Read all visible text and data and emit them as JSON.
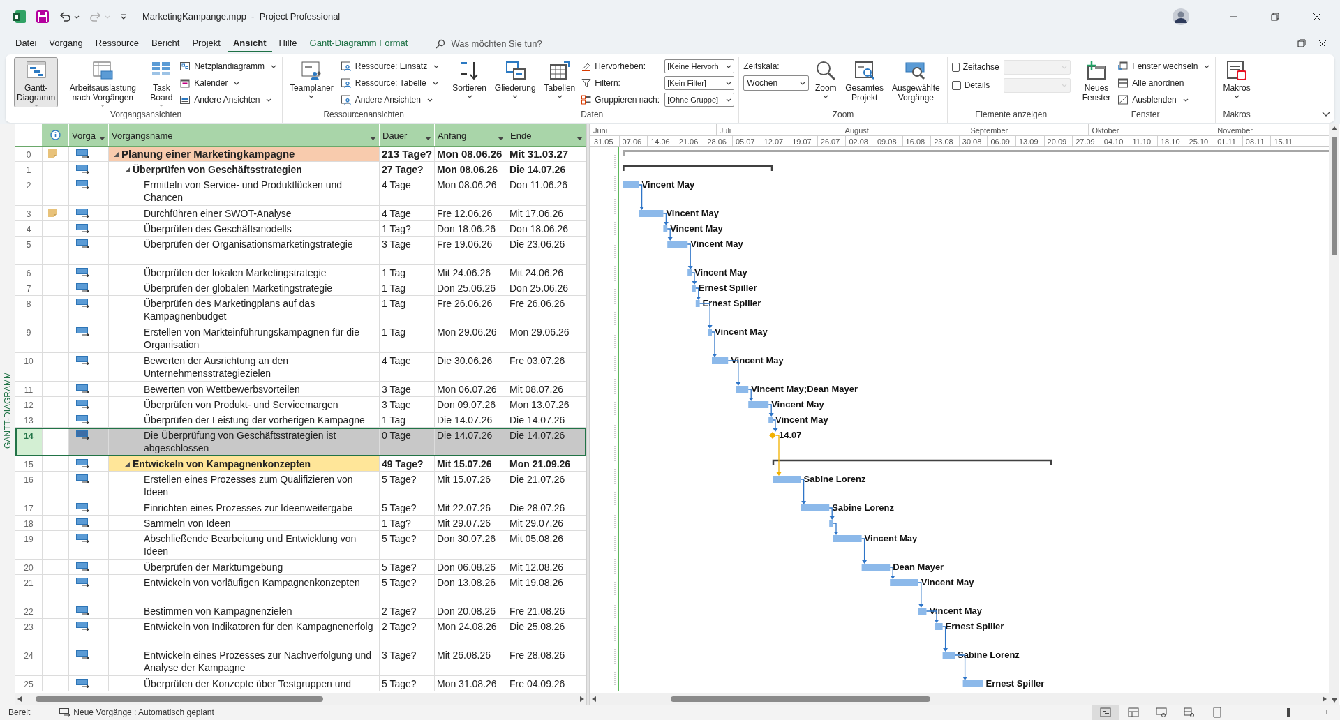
{
  "title_bar": {
    "title": "MarketingKampange.mpp  -  Project Professional"
  },
  "menu_tabs": [
    {
      "label": "Datei",
      "kind": "standard",
      "selected": false
    },
    {
      "label": "Vorgang",
      "kind": "standard",
      "selected": false
    },
    {
      "label": "Ressource",
      "kind": "standard",
      "selected": false
    },
    {
      "label": "Bericht",
      "kind": "standard",
      "selected": false
    },
    {
      "label": "Projekt",
      "kind": "standard",
      "selected": false
    },
    {
      "label": "Ansicht",
      "kind": "standard",
      "selected": true
    },
    {
      "label": "Hilfe",
      "kind": "standard",
      "selected": false
    },
    {
      "label": "Gantt-Diagramm Format",
      "kind": "contextual",
      "selected": false
    }
  ],
  "search": {
    "placeholder": "Was möchten Sie tun?"
  },
  "ribbon": {
    "groups": [
      {
        "label": "Vorgangsansichten",
        "items": [
          {
            "kind": "large",
            "label": "Gantt-Diagramm",
            "dropdown": true,
            "selected": true
          },
          {
            "kind": "large",
            "label": "Arbeitsauslastung nach Vorgängen",
            "dropdown": true,
            "selected": false
          },
          {
            "kind": "large",
            "label": "Task Board",
            "dropdown": true,
            "selected": false
          },
          {
            "kind": "small",
            "label": "Netzplandiagramm",
            "dropdown": true,
            "selected": false
          },
          {
            "kind": "small",
            "label": "Kalender",
            "dropdown": true,
            "selected": false
          },
          {
            "kind": "small",
            "label": "Andere Ansichten",
            "dropdown": true,
            "selected": false
          }
        ]
      },
      {
        "label": "Ressourcenansichten",
        "items": [
          {
            "kind": "large",
            "label": "Teamplaner",
            "dropdown": true,
            "selected": false
          },
          {
            "kind": "small",
            "label": "Ressource: Einsatz",
            "dropdown": true,
            "selected": false
          },
          {
            "kind": "small",
            "label": "Ressource: Tabelle",
            "dropdown": true,
            "selected": false
          },
          {
            "kind": "small",
            "label": "Andere Ansichten",
            "dropdown": true,
            "selected": false
          }
        ]
      },
      {
        "label": "Daten",
        "items": [
          {
            "kind": "large",
            "label": "Sortieren",
            "dropdown": true,
            "selected": false
          },
          {
            "kind": "large",
            "label": "Gliederung",
            "dropdown": true,
            "selected": false
          },
          {
            "kind": "large",
            "label": "Tabellen",
            "dropdown": true,
            "selected": false
          },
          {
            "kind": "labeled_select",
            "label": "Hervorheben:",
            "value": "[Keine Hervorh"
          },
          {
            "kind": "labeled_select",
            "label": "Filtern:",
            "value": "[Kein Filter]"
          },
          {
            "kind": "labeled_select",
            "label": "Gruppieren nach:",
            "value": "[Ohne Gruppe]"
          }
        ]
      },
      {
        "label": "Zoom",
        "items": [
          {
            "kind": "select_stacked",
            "label": "Zeitskala:",
            "value": "Wochen"
          },
          {
            "kind": "large",
            "label": "Zoom",
            "dropdown": true,
            "selected": false
          },
          {
            "kind": "large",
            "label": "Gesamtes Projekt",
            "dropdown": false,
            "selected": false
          },
          {
            "kind": "large",
            "label": "Ausgewählte Vorgänge",
            "dropdown": false,
            "selected": false
          }
        ]
      },
      {
        "label": "Elemente anzeigen",
        "items": [
          {
            "kind": "checkbox",
            "label": "Zeitachse",
            "checked": false
          },
          {
            "kind": "checkbox",
            "label": "Details",
            "checked": false
          }
        ]
      },
      {
        "label": "Fenster",
        "items": [
          {
            "kind": "large",
            "label": "Neues Fenster",
            "dropdown": false,
            "selected": false
          },
          {
            "kind": "small",
            "label": "Fenster wechseln",
            "dropdown": true,
            "selected": false
          },
          {
            "kind": "small",
            "label": "Alle anordnen",
            "dropdown": false,
            "selected": false
          },
          {
            "kind": "small",
            "label": "Ausblenden",
            "dropdown": true,
            "selected": false
          }
        ]
      },
      {
        "label": "Makros",
        "items": [
          {
            "kind": "large",
            "label": "Makros",
            "dropdown": true,
            "selected": false
          }
        ]
      }
    ]
  },
  "view_label": "GANTT-DIAGRAMM",
  "table": {
    "columns": [
      {
        "label": "Vorga"
      },
      {
        "label": "Vorgangsname"
      },
      {
        "label": "Dauer"
      },
      {
        "label": "Anfang"
      },
      {
        "label": "Ende"
      }
    ],
    "rows": [
      {
        "number": "0",
        "note": true,
        "name": "Planung einer Marketingkampagne",
        "duration": "213 Tage?",
        "start": "Mon 08.06.26",
        "finish": "Mit 31.03.27",
        "kind": "summary",
        "expanded": true,
        "selected": false,
        "color": "#f8cbad",
        "children": [
          {
            "number": "1",
            "note": false,
            "name": "Überprüfen von Geschäftsstrategien",
            "duration": "27 Tage?",
            "start": "Mon 08.06.26",
            "finish": "Die 14.07.26",
            "kind": "summary",
            "expanded": true,
            "selected": false,
            "children": [
              {
                "number": "2",
                "note": false,
                "name": "Ermitteln von Service- und Produktlücken und Chancen",
                "duration": "4 Tage",
                "start": "Mon 08.06.26",
                "finish": "Don 11.06.26",
                "kind": "task",
                "selected": false,
                "gantt_label": "Vincent May"
              },
              {
                "number": "3",
                "note": true,
                "name": "Durchführen einer SWOT-Analyse",
                "duration": "4 Tage",
                "start": "Fre 12.06.26",
                "finish": "Mit 17.06.26",
                "kind": "task",
                "selected": false,
                "gantt_label": "Vincent May"
              },
              {
                "number": "4",
                "note": false,
                "name": "Überprüfen des Geschäftsmodells",
                "duration": "1 Tag?",
                "start": "Don 18.06.26",
                "finish": "Don 18.06.26",
                "kind": "task",
                "selected": false,
                "gantt_label": "Vincent May"
              },
              {
                "number": "5",
                "note": false,
                "name": "Überprüfen der Organisationsmarketingstrategie",
                "duration": "3 Tage",
                "start": "Fre 19.06.26",
                "finish": "Die 23.06.26",
                "kind": "task",
                "selected": false,
                "gantt_label": "Vincent May"
              },
              {
                "number": "6",
                "note": false,
                "name": "Überprüfen der lokalen Marketingstrategie",
                "duration": "1 Tag",
                "start": "Mit 24.06.26",
                "finish": "Mit 24.06.26",
                "kind": "task",
                "selected": false,
                "gantt_label": "Vincent May"
              },
              {
                "number": "7",
                "note": false,
                "name": "Überprüfen der globalen Marketingstrategie",
                "duration": "1 Tag",
                "start": "Don 25.06.26",
                "finish": "Don 25.06.26",
                "kind": "task",
                "selected": false,
                "gantt_label": "Ernest Spiller"
              },
              {
                "number": "8",
                "note": false,
                "name": "Überprüfen des Marketingplans auf das Kampagnenbudget",
                "duration": "1 Tag",
                "start": "Fre 26.06.26",
                "finish": "Fre 26.06.26",
                "kind": "task",
                "selected": false,
                "gantt_label": "Ernest Spiller"
              },
              {
                "number": "9",
                "note": false,
                "name": "Erstellen von Markteinführungskampagnen für die Organisation",
                "duration": "1 Tag",
                "start": "Mon 29.06.26",
                "finish": "Mon 29.06.26",
                "kind": "task",
                "selected": false,
                "gantt_label": "Vincent May"
              },
              {
                "number": "10",
                "note": false,
                "name": "Bewerten der Ausrichtung an den Unternehmensstrategiezielen",
                "duration": "4 Tage",
                "start": "Die 30.06.26",
                "finish": "Fre 03.07.26",
                "kind": "task",
                "selected": false,
                "gantt_label": "Vincent May"
              },
              {
                "number": "11",
                "note": false,
                "name": "Bewerten von Wettbewerbsvorteilen",
                "duration": "3 Tage",
                "start": "Mon 06.07.26",
                "finish": "Mit 08.07.26",
                "kind": "task",
                "selected": false,
                "gantt_label": "Vincent May;Dean Mayer"
              },
              {
                "number": "12",
                "note": false,
                "name": "Überprüfen von Produkt- und Servicemargen",
                "duration": "3 Tage",
                "start": "Don 09.07.26",
                "finish": "Mon 13.07.26",
                "kind": "task",
                "selected": false,
                "gantt_label": "Vincent May"
              },
              {
                "number": "13",
                "note": false,
                "name": "Überprüfen der Leistung der vorherigen Kampagne",
                "duration": "1 Tag",
                "start": "Die 14.07.26",
                "finish": "Die 14.07.26",
                "kind": "task",
                "selected": false,
                "gantt_label": "Vincent May"
              },
              {
                "number": "14",
                "note": false,
                "name": "Die Überprüfung von Geschäftsstrategien ist abgeschlossen",
                "duration": "0 Tage",
                "start": "Die 14.07.26",
                "finish": "Die 14.07.26",
                "kind": "milestone",
                "selected": true,
                "gantt_label": "14.07"
              }
            ]
          },
          {
            "number": "15",
            "note": false,
            "name": "Entwickeln von Kampagnenkonzepten",
            "duration": "49 Tage?",
            "start": "Mit 15.07.26",
            "finish": "Mon 21.09.26",
            "kind": "summary",
            "expanded": true,
            "selected": false,
            "color": "#ffe699",
            "children": [
              {
                "number": "16",
                "note": false,
                "name": "Erstellen eines Prozesses zum Qualifizieren von Ideen",
                "duration": "5 Tage?",
                "start": "Mit 15.07.26",
                "finish": "Die 21.07.26",
                "kind": "task",
                "selected": false,
                "gantt_label": "Sabine Lorenz"
              },
              {
                "number": "17",
                "note": false,
                "name": "Einrichten eines Prozesses zur Ideenweitergabe",
                "duration": "5 Tage?",
                "start": "Mit 22.07.26",
                "finish": "Die 28.07.26",
                "kind": "task",
                "selected": false,
                "gantt_label": "Sabine Lorenz"
              },
              {
                "number": "18",
                "note": false,
                "name": "Sammeln von Ideen",
                "duration": "1 Tag?",
                "start": "Mit 29.07.26",
                "finish": "Mit 29.07.26",
                "kind": "task",
                "selected": false
              },
              {
                "number": "19",
                "note": false,
                "name": "Abschließende Bearbeitung und Entwicklung von Ideen",
                "duration": "5 Tage?",
                "start": "Don 30.07.26",
                "finish": "Mit 05.08.26",
                "kind": "task",
                "selected": false,
                "gantt_label": "Vincent May"
              },
              {
                "number": "20",
                "note": false,
                "name": "Überprüfen der Marktumgebung",
                "duration": "5 Tage?",
                "start": "Don 06.08.26",
                "finish": "Mit 12.08.26",
                "kind": "task",
                "selected": false,
                "gantt_label": "Dean Mayer"
              },
              {
                "number": "21",
                "note": false,
                "name": "Entwickeln von vorläufigen Kampagnenkonzepten",
                "duration": "5 Tage?",
                "start": "Don 13.08.26",
                "finish": "Mit 19.08.26",
                "kind": "task",
                "selected": false,
                "gantt_label": "Vincent May"
              },
              {
                "number": "22",
                "note": false,
                "name": "Bestimmen von Kampagnenzielen",
                "duration": "2 Tage?",
                "start": "Don 20.08.26",
                "finish": "Fre 21.08.26",
                "kind": "task",
                "selected": false,
                "gantt_label": "Vincent May"
              },
              {
                "number": "23",
                "note": false,
                "name": "Entwickeln von Indikatoren für den Kampagnenerfolg",
                "duration": "2 Tage?",
                "start": "Mon 24.08.26",
                "finish": "Die 25.08.26",
                "kind": "task",
                "selected": false,
                "gantt_label": "Ernest Spiller"
              },
              {
                "number": "24",
                "note": false,
                "name": "Entwickeln eines Prozesses zur Nachverfolgung und Analyse der Kampagne",
                "duration": "3 Tage?",
                "start": "Mit 26.08.26",
                "finish": "Fre 28.08.26",
                "kind": "task",
                "selected": false,
                "gantt_label": "Sabine Lorenz"
              },
              {
                "number": "25",
                "note": false,
                "name": "Überprüfen der Konzepte über Testgruppen und",
                "duration": "5 Tage?",
                "start": "Mon 31.08.26",
                "finish": "Fre 04.09.26",
                "kind": "task",
                "selected": false,
                "gantt_label": "Ernest Spiller"
              }
            ]
          }
        ]
      }
    ]
  },
  "timescale": {
    "months": [
      "Juni",
      "Juli",
      "August",
      "September",
      "Oktober",
      "November"
    ],
    "weeks": [
      "31.05",
      "07.06",
      "14.06",
      "21.06",
      "28.06",
      "05.07",
      "12.07",
      "19.07",
      "26.07",
      "02.08",
      "09.08",
      "16.08",
      "23.08",
      "30.08",
      "06.09",
      "13.09",
      "20.09",
      "27.09",
      "04.10",
      "11.10",
      "18.10",
      "25.10",
      "01.11",
      "08.11",
      "15.11"
    ]
  },
  "status_bar": {
    "ready": "Bereit",
    "new_tasks": "Neue Vorgänge : Automatisch geplant",
    "views": [
      {
        "selected": true
      },
      {
        "selected": false
      },
      {
        "selected": false
      },
      {
        "selected": false
      },
      {
        "selected": false
      }
    ],
    "zoom_out": "−",
    "zoom_in": "+",
    "zoom_slider": {
      "level": 0.53
    }
  }
}
